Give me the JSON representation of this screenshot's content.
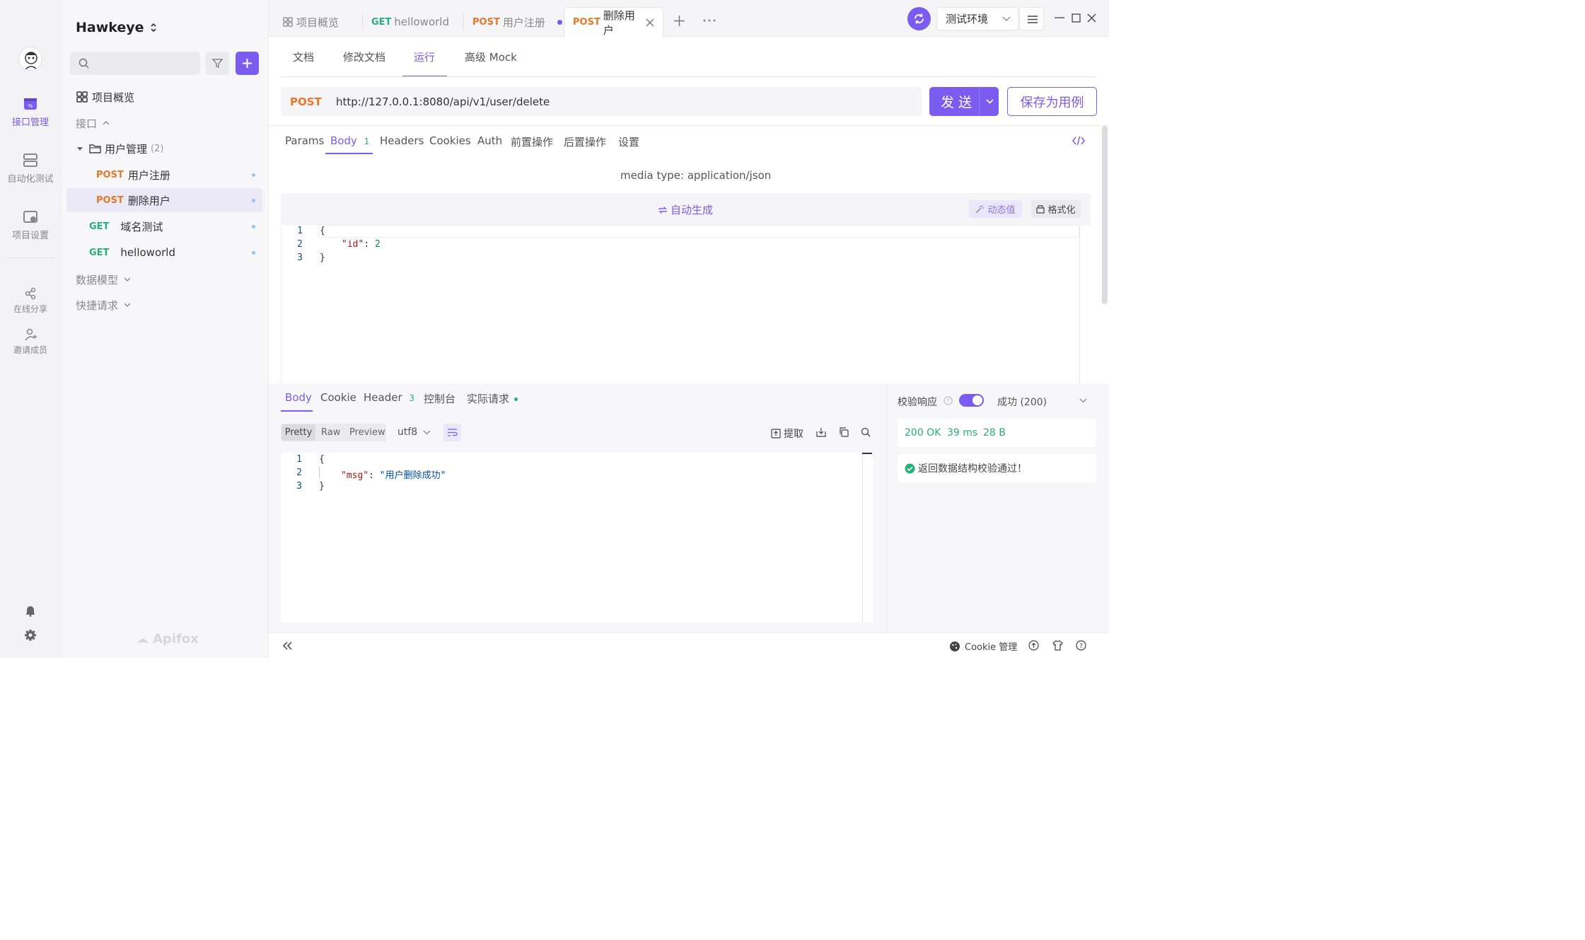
{
  "colors": {
    "accent": "#7b5cf0",
    "post": "#e8772a",
    "get": "#26b079",
    "success": "#26b079"
  },
  "rail": {
    "items": [
      {
        "label": "接口管理",
        "icon": "api-icon",
        "active": true
      },
      {
        "label": "自动化测试",
        "icon": "automation-icon"
      },
      {
        "label": "项目设置",
        "icon": "project-settings-icon"
      },
      {
        "label": "在线分享",
        "icon": "share-icon"
      },
      {
        "label": "邀请成员",
        "icon": "invite-icon"
      }
    ]
  },
  "sidebar": {
    "project_name": "Hawkeye",
    "overview": "项目概览",
    "section_api": "接口",
    "folder": {
      "name": "用户管理",
      "count": "(2)"
    },
    "items": [
      {
        "method": "POST",
        "name": "用户注册"
      },
      {
        "method": "POST",
        "name": "删除用户"
      },
      {
        "method": "GET",
        "name": "域名测试"
      },
      {
        "method": "GET",
        "name": "helloworld"
      }
    ],
    "section_models": "数据模型",
    "section_quick": "快捷请求",
    "brand": "Apifox"
  },
  "tabs": [
    {
      "method": "",
      "label": "项目概览"
    },
    {
      "method": "GET",
      "label": "helloworld"
    },
    {
      "method": "POST",
      "label": "用户注册"
    },
    {
      "method": "POST",
      "label": "删除用户"
    }
  ],
  "env": {
    "label": "测试环境"
  },
  "subtabs": [
    "文档",
    "修改文档",
    "运行",
    "高级 Mock"
  ],
  "request": {
    "method": "POST",
    "url": "http://127.0.0.1:8080/api/v1/user/delete",
    "send": "发 送",
    "save": "保存为用例"
  },
  "req_tabs": {
    "params": "Params",
    "body": "Body",
    "body_count": "1",
    "headers": "Headers",
    "cookies": "Cookies",
    "auth": "Auth",
    "pre": "前置操作",
    "post": "后置操作",
    "settings": "设置"
  },
  "body_editor": {
    "media_type": "media type: application/json",
    "auto_gen": "自动生成",
    "dynamic": "动态值",
    "format": "格式化",
    "lines": [
      "1",
      "2",
      "3"
    ],
    "brace_open": "{",
    "key": "\"id\"",
    "colon": ":",
    "value": "2",
    "brace_close": "}"
  },
  "response": {
    "tabs": {
      "body": "Body",
      "cookie": "Cookie",
      "header": "Header",
      "header_count": "3",
      "console": "控制台",
      "actual": "实际请求"
    },
    "view": [
      "Pretty",
      "Raw",
      "Preview"
    ],
    "encoding": "utf8",
    "extract": "提取",
    "lines": [
      "1",
      "2",
      "3"
    ],
    "brace_open": "{",
    "key": "\"msg\"",
    "colon": ":",
    "value": "\"用户删除成功\"",
    "brace_close": "}"
  },
  "validation": {
    "label": "校验响应",
    "status": "成功 (200)",
    "code": "200 OK",
    "time": "39 ms",
    "size": "28 B",
    "message": "返回数据结构校验通过！"
  },
  "footer": {
    "cookie": "Cookie 管理"
  }
}
